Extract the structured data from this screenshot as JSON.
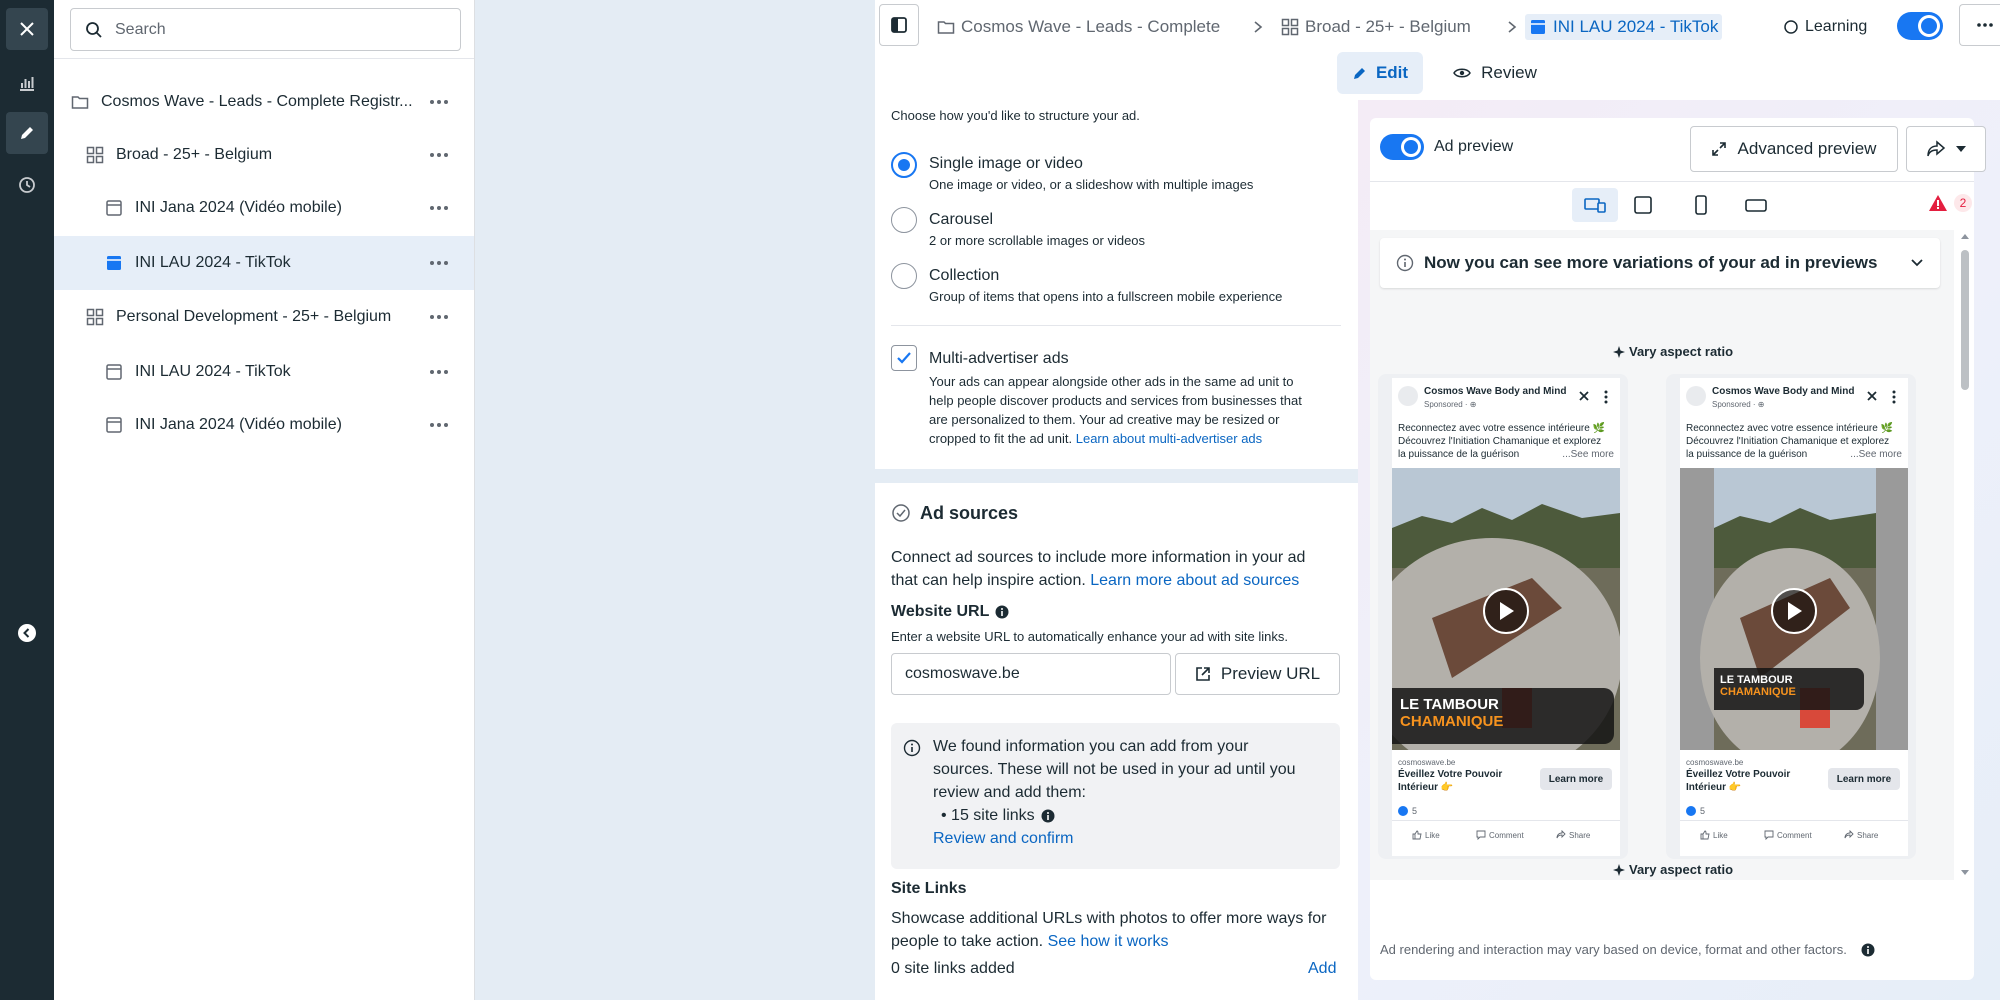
{
  "rail": {
    "icons": [
      "close-icon",
      "bar-chart-icon",
      "pencil-icon",
      "clock-icon",
      "collapse-icon"
    ]
  },
  "tree": {
    "search_placeholder": "Search",
    "items": [
      {
        "label": "Cosmos Wave - Leads - Complete Registr...",
        "icon": "folder-icon",
        "level": 0
      },
      {
        "label": "Broad - 25+ - Belgium",
        "icon": "grid-icon",
        "level": 1
      },
      {
        "label": "INI Jana 2024 (Vidéo mobile)",
        "icon": "ad-icon",
        "level": 2
      },
      {
        "label": "INI LAU 2024 - TikTok",
        "icon": "ad-icon",
        "level": 2,
        "selected": true
      },
      {
        "label": "Personal Development - 25+ - Belgium",
        "icon": "grid-icon",
        "level": 1
      },
      {
        "label": "INI LAU 2024 - TikTok",
        "icon": "ad-icon",
        "level": 2
      },
      {
        "label": "INI Jana 2024 (Vidéo mobile)",
        "icon": "ad-icon",
        "level": 2
      }
    ]
  },
  "topbar": {
    "breadcrumbs": [
      "Cosmos Wave - Leads - Complete",
      "Broad - 25+ - Belgium",
      "INI LAU 2024 - TikTok"
    ],
    "status": "Learning",
    "tabs": {
      "edit": "Edit",
      "review": "Review"
    }
  },
  "format": {
    "prompt": "Choose how you'd like to structure your ad.",
    "options": [
      {
        "title": "Single image or video",
        "desc": "One image or video, or a slideshow with multiple images",
        "selected": true
      },
      {
        "title": "Carousel",
        "desc": "2 or more scrollable images or videos",
        "selected": false
      },
      {
        "title": "Collection",
        "desc": "Group of items that opens into a fullscreen mobile experience",
        "selected": false
      }
    ],
    "multi": {
      "title": "Multi-advertiser ads",
      "desc_lines": [
        "Your ads can appear alongside other ads in the same ad unit to",
        "help people discover products and services from businesses that",
        "are personalized to them. Your ad creative may be resized or"
      ],
      "desc_last": "cropped to fit the ad unit.",
      "link": "Learn about multi-advertiser ads",
      "checked": true
    }
  },
  "sources": {
    "title": "Ad sources",
    "desc_line1": "Connect ad sources to include more information in your ad",
    "desc_line2": "that can help inspire action.",
    "desc_link": "Learn more about ad sources",
    "url_label": "Website URL",
    "url_hint": "Enter a website URL to automatically enhance your ad with site links.",
    "url_value": "cosmoswave.be",
    "preview_url_label": "Preview URL",
    "info_lines": [
      "We found information you can add from your",
      "sources. These will not be used in your ad until you",
      "review and add them:"
    ],
    "site_links_bullet": "• 15 site links",
    "review_link": "Review and confirm",
    "site_links_title": "Site Links",
    "site_links_desc1": "Showcase additional URLs with photos to offer more ways for",
    "site_links_desc2": "people to take action.",
    "site_links_link": "See how it works",
    "site_links_count": "0 site links added",
    "add_label": "Add"
  },
  "preview": {
    "toggle_label": "Ad preview",
    "advanced_label": "Advanced preview",
    "warning_count": "2",
    "banner": "Now you can see more variations of your ad in previews",
    "vary_label": "Vary aspect ratio",
    "footer_note": "Ad rendering and interaction may vary based on device, format and other factors.",
    "ad": {
      "page_name": "Cosmos Wave Body and Mind",
      "sponsored": "Sponsored · ⊕",
      "text_line1": "Reconnectez avec votre essence intérieure 🌿",
      "text_line2": "Découvrez l'Initiation Chamanique et explorez",
      "text_line3": "la puissance de la guérison",
      "see_more": "...See more",
      "overlay_line1": "LE TAMBOUR",
      "overlay_line2": "CHAMANIQUE",
      "domain": "cosmoswave.be",
      "headline_line1": "Éveillez Votre Pouvoir",
      "headline_line2": "Intérieur 👉",
      "cta": "Learn more",
      "reactions": "5",
      "actions": [
        "Like",
        "Comment",
        "Share"
      ]
    }
  },
  "colors": {
    "accent": "#1877f2",
    "link": "#0a66c2",
    "rail": "#1c2b33",
    "selected_row": "#e6eef8",
    "warning": "#e41e3f",
    "overlay_orange": "#f7931e"
  }
}
